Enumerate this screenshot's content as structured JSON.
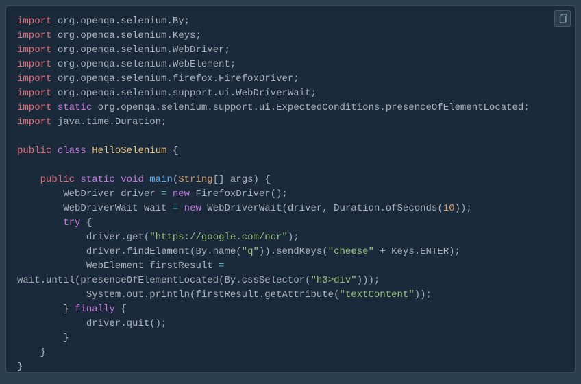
{
  "copy_tooltip": "Copy",
  "code": {
    "lines": [
      [
        {
          "t": "kw",
          "v": "import "
        },
        {
          "t": "txt",
          "v": "org.openqa.selenium.By;"
        }
      ],
      [
        {
          "t": "kw",
          "v": "import "
        },
        {
          "t": "txt",
          "v": "org.openqa.selenium.Keys;"
        }
      ],
      [
        {
          "t": "kw",
          "v": "import "
        },
        {
          "t": "txt",
          "v": "org.openqa.selenium.WebDriver;"
        }
      ],
      [
        {
          "t": "kw",
          "v": "import "
        },
        {
          "t": "txt",
          "v": "org.openqa.selenium.WebElement;"
        }
      ],
      [
        {
          "t": "kw",
          "v": "import "
        },
        {
          "t": "txt",
          "v": "org.openqa.selenium.firefox.FirefoxDriver;"
        }
      ],
      [
        {
          "t": "kw",
          "v": "import "
        },
        {
          "t": "txt",
          "v": "org.openqa.selenium.support.ui.WebDriverWait;"
        }
      ],
      [
        {
          "t": "kw",
          "v": "import "
        },
        {
          "t": "kw2",
          "v": "static "
        },
        {
          "t": "txt",
          "v": "org.openqa.selenium.support.ui.ExpectedConditions.presenceOfElementLocated;"
        }
      ],
      [
        {
          "t": "kw",
          "v": "import "
        },
        {
          "t": "txt",
          "v": "java.time.Duration;"
        }
      ],
      [
        {
          "t": "txt",
          "v": " "
        }
      ],
      [
        {
          "t": "kw",
          "v": "public "
        },
        {
          "t": "kw2",
          "v": "class "
        },
        {
          "t": "cls",
          "v": "HelloSelenium "
        },
        {
          "t": "pun",
          "v": "{"
        }
      ],
      [
        {
          "t": "txt",
          "v": " "
        }
      ],
      [
        {
          "t": "txt",
          "v": "    "
        },
        {
          "t": "kw",
          "v": "public "
        },
        {
          "t": "kw2",
          "v": "static "
        },
        {
          "t": "dtype",
          "v": "void "
        },
        {
          "t": "fn",
          "v": "main"
        },
        {
          "t": "pun",
          "v": "("
        },
        {
          "t": "type",
          "v": "String"
        },
        {
          "t": "pun",
          "v": "[] args) {"
        }
      ],
      [
        {
          "t": "txt",
          "v": "        WebDriver driver "
        },
        {
          "t": "op",
          "v": "= "
        },
        {
          "t": "kw2",
          "v": "new "
        },
        {
          "t": "txt",
          "v": "FirefoxDriver();"
        }
      ],
      [
        {
          "t": "txt",
          "v": "        WebDriverWait wait "
        },
        {
          "t": "op",
          "v": "= "
        },
        {
          "t": "kw2",
          "v": "new "
        },
        {
          "t": "txt",
          "v": "WebDriverWait(driver, Duration.ofSeconds("
        },
        {
          "t": "num",
          "v": "10"
        },
        {
          "t": "txt",
          "v": "));"
        }
      ],
      [
        {
          "t": "txt",
          "v": "        "
        },
        {
          "t": "kw2",
          "v": "try "
        },
        {
          "t": "pun",
          "v": "{"
        }
      ],
      [
        {
          "t": "txt",
          "v": "            driver.get("
        },
        {
          "t": "str",
          "v": "\"https://google.com/ncr\""
        },
        {
          "t": "txt",
          "v": ");"
        }
      ],
      [
        {
          "t": "txt",
          "v": "            driver.findElement(By.name("
        },
        {
          "t": "str",
          "v": "\"q\""
        },
        {
          "t": "txt",
          "v": ")).sendKeys("
        },
        {
          "t": "str",
          "v": "\"cheese\""
        },
        {
          "t": "txt",
          "v": " + Keys.ENTER);"
        }
      ],
      [
        {
          "t": "txt",
          "v": "            WebElement firstResult "
        },
        {
          "t": "op",
          "v": "= "
        },
        {
          "t": "txt",
          "v": "wait.until(presenceOfElementLocated(By.cssSelector("
        },
        {
          "t": "str",
          "v": "\"h3>div\""
        },
        {
          "t": "txt",
          "v": ")));"
        }
      ],
      [
        {
          "t": "txt",
          "v": "            System.out.println(firstResult.getAttribute("
        },
        {
          "t": "str",
          "v": "\"textContent\""
        },
        {
          "t": "txt",
          "v": "));"
        }
      ],
      [
        {
          "t": "txt",
          "v": "        } "
        },
        {
          "t": "kw2",
          "v": "finally "
        },
        {
          "t": "pun",
          "v": "{"
        }
      ],
      [
        {
          "t": "txt",
          "v": "            driver.quit();"
        }
      ],
      [
        {
          "t": "txt",
          "v": "        }"
        }
      ],
      [
        {
          "t": "txt",
          "v": "    }"
        }
      ],
      [
        {
          "t": "txt",
          "v": "}"
        }
      ]
    ]
  }
}
